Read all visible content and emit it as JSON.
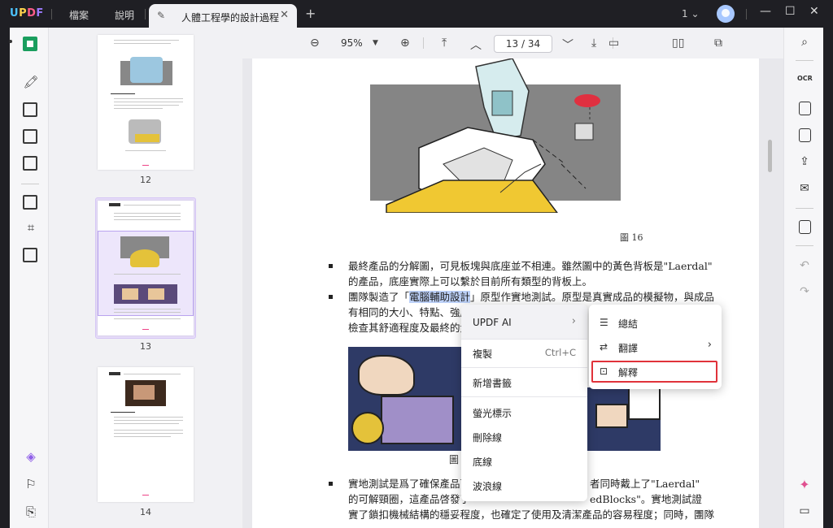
{
  "app": {
    "logo": "UPDF",
    "menu": [
      "檔案",
      "說明"
    ],
    "tab_title": "人體工程學的設計過程",
    "window_count": "1",
    "icons": [
      "edit-icon",
      "close-icon",
      "plus-icon",
      "chevron-down-icon",
      "minimize-icon",
      "maximize-icon",
      "close-window-icon"
    ]
  },
  "toolbar": {
    "zoom": "95%",
    "page_current": "13",
    "page_total": "34",
    "page_display": "13 / 34"
  },
  "thumbnails": [
    {
      "page": "12"
    },
    {
      "page": "13"
    },
    {
      "page": "14"
    }
  ],
  "document": {
    "figure_caption": "圖 16",
    "figure_caption_2": "圖",
    "para1_line1": "最終產品的分解圖，可見板塊與底座並不相連。雖然圖中的黃色背板是\"Laerdal\"",
    "para1_line2": "的產品，底座實際上可以繫於目前所有類型的背板上。",
    "para2_line1_pre": "團隊製造了「",
    "para2_line1_hl": "電腦輔助設計",
    "para2_line1_post": "」原型作實地測試。原型是真實成品的模擬物，與成品",
    "para2_line2": "有相同的大小、特點、強度",
    "para2_line3": "檢查其舒適程度及最終的大",
    "para3_line1_pre": "實地測試是爲了確保產品可",
    "para3_line1_post": "者同時戴上了\"Laerdal\"",
    "para3_line2_pre": "的可解頸圈，這產品啓發了",
    "para3_line2_post": "edBlocks\"。實地測試證",
    "para3_line3": "實了鎖扣機械結構的穩妥程度，也確定了使用及清潔產品的容易程度；同時，團隊"
  },
  "context_menu": {
    "updf_ai": "UPDF AI",
    "copy": "複製",
    "copy_shortcut": "Ctrl+C",
    "add_bookmark": "新增書籤",
    "highlight": "螢光標示",
    "strikethrough": "刪除線",
    "underline": "底線",
    "squiggly": "波浪線"
  },
  "ai_submenu": {
    "summarize": "總結",
    "translate": "翻譯",
    "explain": "解釋"
  },
  "colors": {
    "accent_green": "#1a9e5e",
    "selection_purple": "#e6dcf9",
    "highlight_blue": "#bcd0f7",
    "explain_border": "#e0323a"
  }
}
